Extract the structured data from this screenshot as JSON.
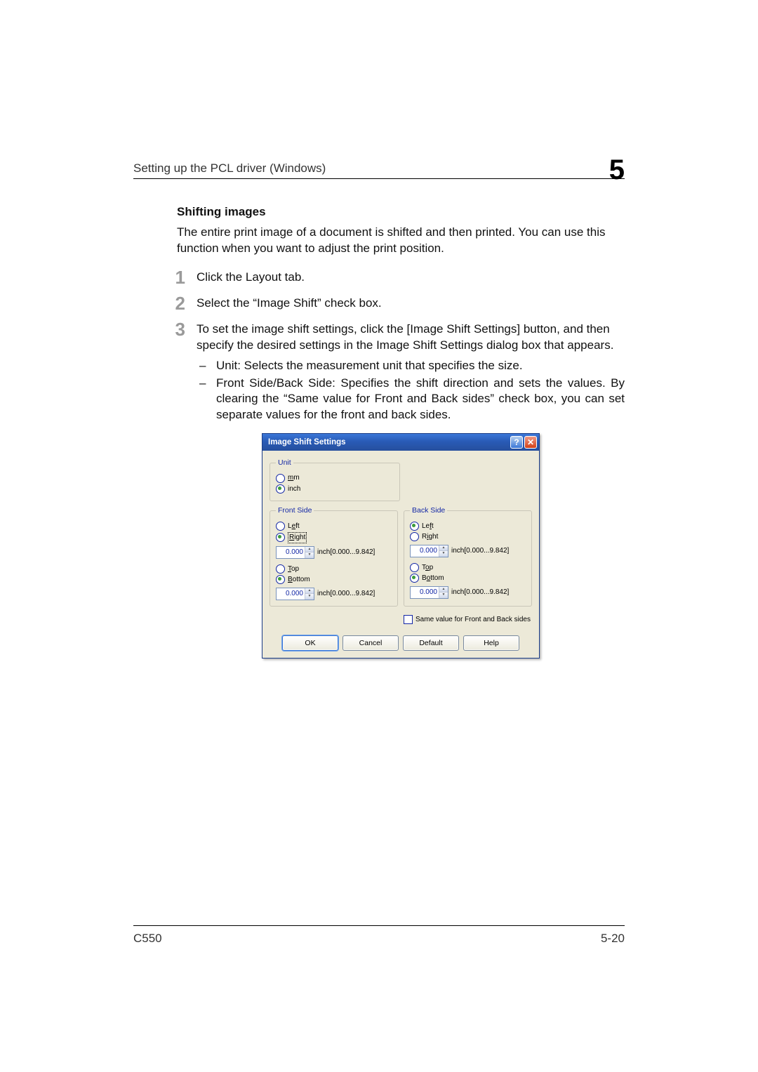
{
  "header": {
    "running_title": "Setting up the PCL driver (Windows)",
    "chapter": "5"
  },
  "section": {
    "heading": "Shifting images",
    "intro": "The entire print image of a document is shifted and then printed. You can use this function when you want to adjust the print position.",
    "steps": [
      {
        "num": "1",
        "text": "Click the Layout tab."
      },
      {
        "num": "2",
        "text": "Select the “Image Shift” check box."
      },
      {
        "num": "3",
        "text": "To set the image shift settings, click the [Image Shift Settings] button, and then specify the desired settings in the Image Shift Settings dialog box that appears."
      }
    ],
    "sub_bullets": [
      "Unit: Selects the measurement unit that specifies the size.",
      "Front Side/Back Side: Specifies the shift direction and sets the values. By clearing the “Same value for Front and Back sides” check box, you can set separate values for the front and back sides."
    ]
  },
  "dialog": {
    "title": "Image Shift Settings",
    "unit": {
      "legend": "Unit",
      "mm": "mm",
      "inch": "inch"
    },
    "front": {
      "legend": "Front Side",
      "left": "Left",
      "right": "Right",
      "top": "Top",
      "bottom": "Bottom",
      "value1": "0.000",
      "value2": "0.000",
      "range": "inch[0.000...9.842]"
    },
    "back": {
      "legend": "Back Side",
      "left": "Left",
      "right": "Right",
      "top": "Top",
      "bottom": "Bottom",
      "value1": "0.000",
      "value2": "0.000",
      "range": "inch[0.000...9.842]"
    },
    "same": "Same value for Front and Back sides",
    "buttons": {
      "ok": "OK",
      "cancel": "Cancel",
      "default": "Default",
      "help": "Help"
    }
  },
  "footer": {
    "left": "C550",
    "right": "5-20"
  }
}
